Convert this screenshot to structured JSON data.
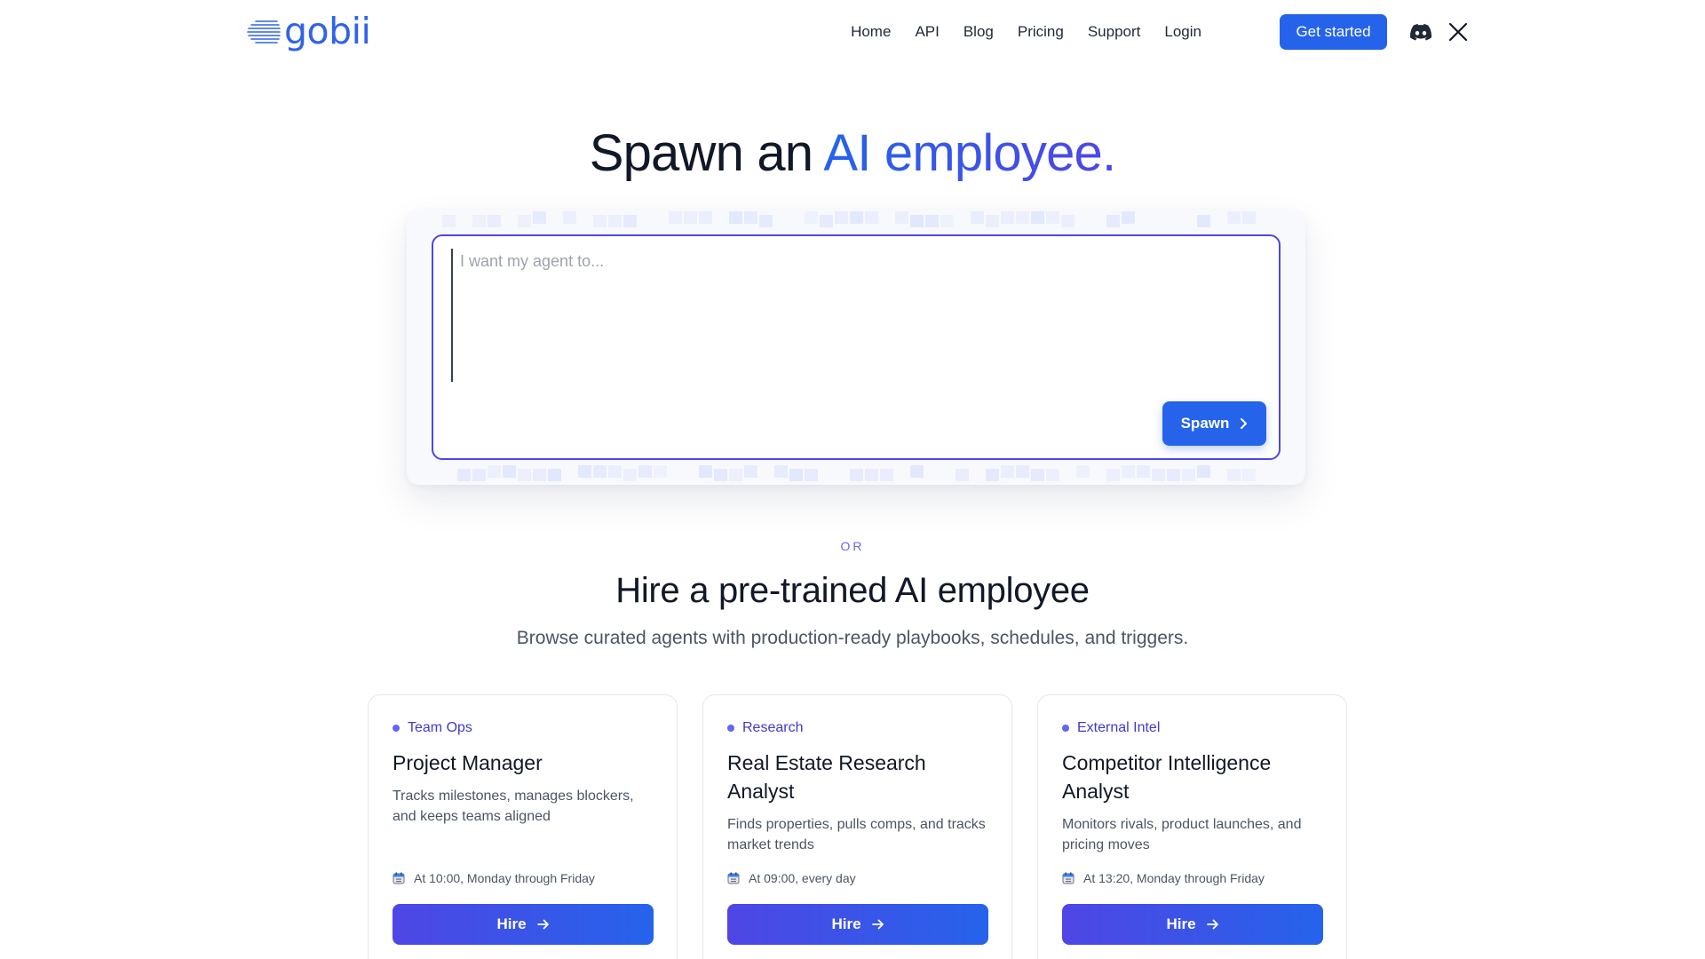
{
  "brand": {
    "name": "gobii",
    "logo_icon": "speed-lines-logo-icon"
  },
  "nav": {
    "links": [
      "Home",
      "API",
      "Blog",
      "Pricing",
      "Support",
      "Login"
    ],
    "cta_label": "Get started",
    "social": [
      {
        "icon": "discord-icon"
      },
      {
        "icon": "x-icon"
      }
    ]
  },
  "hero": {
    "title_plain": "Spawn an",
    "title_accent": "AI employee.",
    "input_placeholder": "I want my agent to...",
    "spawn_label": "Spawn"
  },
  "catalog": {
    "or_label": "OR",
    "title": "Hire a pre-trained AI employee",
    "subtitle": "Browse curated agents with production-ready playbooks, schedules, and triggers.",
    "cards": [
      {
        "tag": "Team Ops",
        "title": "Project Manager",
        "description": "Tracks milestones, manages blockers, and keeps teams aligned",
        "schedule": "At 10:00, Monday through Friday",
        "hire_label": "Hire"
      },
      {
        "tag": "Research",
        "title": "Real Estate Research Analyst",
        "description": "Finds properties, pulls comps, and tracks market trends",
        "schedule": "At 09:00, every day",
        "hire_label": "Hire"
      },
      {
        "tag": "External Intel",
        "title": "Competitor Intelligence Analyst",
        "description": "Monitors rivals, product launches, and pricing moves",
        "schedule": "At 13:20, Monday through Friday",
        "hire_label": "Hire"
      }
    ]
  },
  "colors": {
    "primary": "#2563eb",
    "accent_indigo": "#4f46e5",
    "tag_text": "#4338ca",
    "text_dark": "#111827",
    "text_muted": "#4b5563"
  }
}
